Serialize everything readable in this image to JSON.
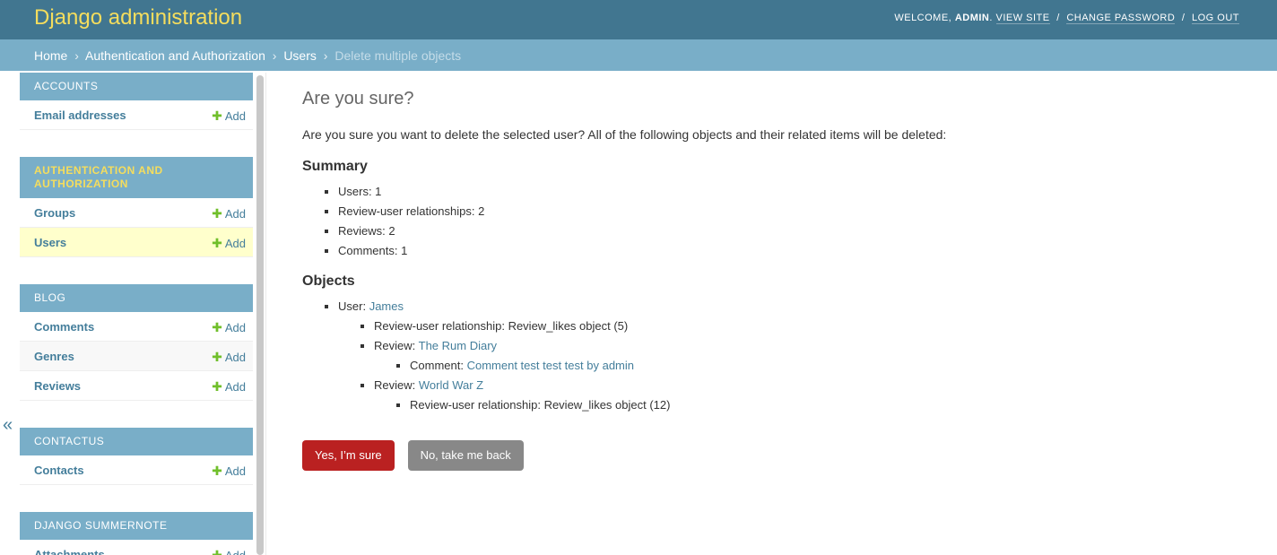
{
  "header": {
    "branding": "Django administration",
    "welcome": "WELCOME,",
    "username": "ADMIN",
    "view_site": "VIEW SITE",
    "change_password": "CHANGE PASSWORD",
    "log_out": "LOG OUT",
    "separator": "/"
  },
  "breadcrumbs": {
    "home": "Home",
    "app": "Authentication and Authorization",
    "model": "Users",
    "current": "Delete multiple objects",
    "separator": "›"
  },
  "sidebar": {
    "toggle": "«",
    "add_label": "Add",
    "modules": [
      {
        "caption": "Accounts",
        "models": [
          {
            "name": "Email addresses"
          }
        ]
      },
      {
        "caption": "Authentication and Authorization",
        "models": [
          {
            "name": "Groups"
          },
          {
            "name": "Users"
          }
        ]
      },
      {
        "caption": "Blog",
        "models": [
          {
            "name": "Comments"
          },
          {
            "name": "Genres"
          },
          {
            "name": "Reviews"
          }
        ]
      },
      {
        "caption": "Contactus",
        "models": [
          {
            "name": "Contacts"
          }
        ]
      },
      {
        "caption": "Django Summernote",
        "models": [
          {
            "name": "Attachments"
          }
        ]
      }
    ]
  },
  "content": {
    "title": "Are you sure?",
    "intro": "Are you sure you want to delete the selected user? All of the following objects and their related items will be deleted:",
    "summary_heading": "Summary",
    "summary": [
      "Users: 1",
      "Review-user relationships: 2",
      "Reviews: 2",
      "Comments: 1"
    ],
    "objects_heading": "Objects",
    "objects": {
      "user_prefix": "User:",
      "user_link": "James",
      "rel1": "Review-user relationship: Review_likes object (5)",
      "review1_prefix": "Review:",
      "review1_link": "The Rum Diary",
      "comment_prefix": "Comment:",
      "comment_link": "Comment test test test by admin",
      "review2_prefix": "Review:",
      "review2_link": "World War Z",
      "rel2": "Review-user relationship: Review_likes object (12)"
    },
    "confirm_button": "Yes, I’m sure",
    "cancel_button": "No, take me back"
  },
  "colors": {
    "header_bg": "#417690",
    "breadcrumbs_bg": "#79aec8",
    "branding": "#f5dd5d",
    "link": "#447e9b",
    "add_plus": "#70bf2b",
    "delete_button": "#ba2121",
    "cancel_button": "#888888",
    "selected_row": "#ffffcc"
  }
}
